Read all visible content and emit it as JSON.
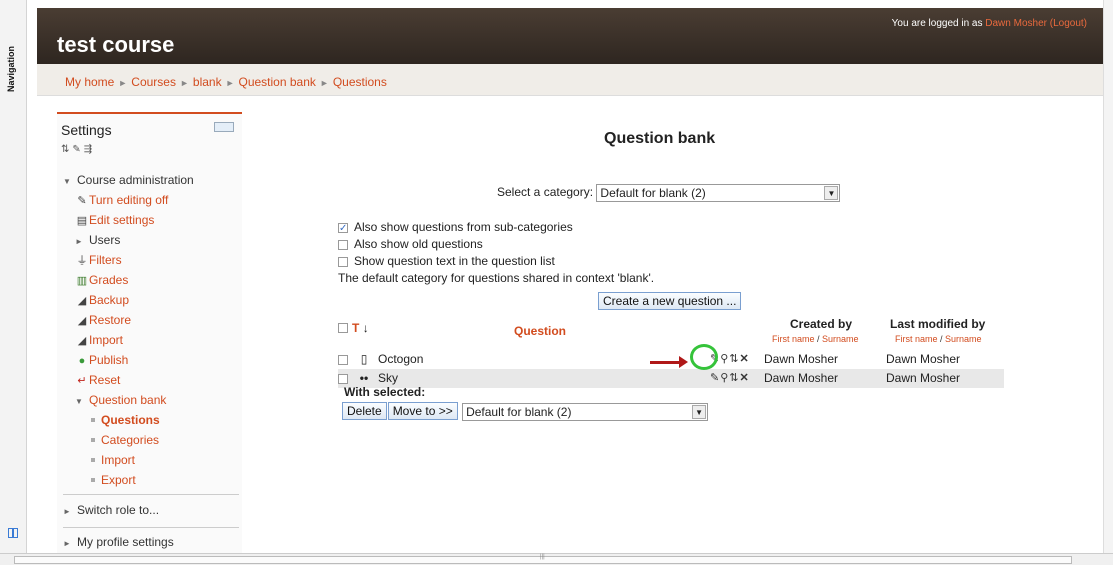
{
  "nav_strip": {
    "label": "Navigation"
  },
  "header": {
    "course_title": "test course",
    "login_prefix": "You are logged in as ",
    "user_name": "Dawn Mosher",
    "logout_label": "(Logout)"
  },
  "breadcrumb": [
    "My home",
    "Courses",
    "blank",
    "Question bank",
    "Questions"
  ],
  "settings": {
    "title": "Settings",
    "course_admin": "Course administration",
    "items": [
      {
        "label": "Turn editing off",
        "icon": "editing-icon"
      },
      {
        "label": "Edit settings",
        "icon": "settings-icon"
      },
      {
        "label": "Users",
        "icon": "caret-right-icon"
      },
      {
        "label": "Filters",
        "icon": "filter-icon"
      },
      {
        "label": "Grades",
        "icon": "grades-icon"
      },
      {
        "label": "Backup",
        "icon": "backup-icon"
      },
      {
        "label": "Restore",
        "icon": "restore-icon"
      },
      {
        "label": "Import",
        "icon": "import-icon"
      },
      {
        "label": "Publish",
        "icon": "publish-icon"
      },
      {
        "label": "Reset",
        "icon": "reset-icon"
      }
    ],
    "question_bank": "Question bank",
    "question_bank_items": [
      "Questions",
      "Categories",
      "Import",
      "Export"
    ],
    "switch_role": "Switch role to...",
    "profile": "My profile settings"
  },
  "main": {
    "title": "Question bank",
    "category_label": "Select a category:",
    "category_value": "Default for blank (2)",
    "options": [
      {
        "label": "Also show questions from sub-categories",
        "checked": true
      },
      {
        "label": "Also show old questions",
        "checked": false
      },
      {
        "label": "Show question text in the question list",
        "checked": false
      }
    ],
    "default_note": "The default category for questions shared in context 'blank'.",
    "create_button": "Create a new question ...",
    "table": {
      "col_t": "T",
      "col_question": "Question",
      "col_created": "Created by",
      "col_modified": "Last modified by",
      "sub_first": "First name",
      "sub_sep": " / ",
      "sub_surname": "Surname",
      "rows": [
        {
          "name": "Octogon",
          "created": "Dawn Mosher",
          "modified": "Dawn Mosher"
        },
        {
          "name": "Sky",
          "created": "Dawn Mosher",
          "modified": "Dawn Mosher"
        }
      ]
    },
    "with_selected": "With selected:",
    "delete_button": "Delete",
    "move_button": "Move to >>",
    "move_target": "Default for blank (2)"
  },
  "colors": {
    "accent": "#d24c1f",
    "header_bg": "#3a3029",
    "callout_circle": "#35c33a",
    "callout_arrow": "#b01818"
  }
}
